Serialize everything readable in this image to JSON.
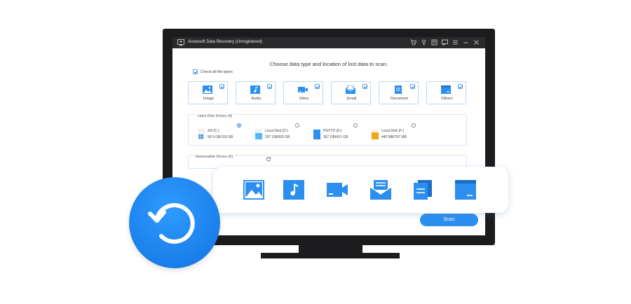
{
  "app": {
    "title": "Aiseesoft Data Recovery (Unregistered)",
    "titlebar_icons": [
      "cart-icon",
      "key-icon",
      "register-icon",
      "feedback-icon",
      "menu-icon",
      "minimize-icon",
      "close-icon"
    ]
  },
  "main": {
    "heading": "Choose data type and location of lost data to scan.",
    "check_all_label": "Check all file types",
    "file_types": [
      {
        "label": "Image",
        "icon": "image-icon",
        "checked": true
      },
      {
        "label": "Audio",
        "icon": "audio-icon",
        "checked": true
      },
      {
        "label": "Video",
        "icon": "video-icon",
        "checked": true
      },
      {
        "label": "Email",
        "icon": "email-icon",
        "checked": true
      },
      {
        "label": "Document",
        "icon": "document-icon",
        "checked": true
      },
      {
        "label": "Others",
        "icon": "others-icon",
        "checked": true
      }
    ],
    "hard_disk": {
      "label": "Hard Disk Drives (4)",
      "drives": [
        {
          "name": "Xiit (C:)",
          "size": "95.5 GB/118 GB",
          "selected": true
        },
        {
          "name": "Local Disk (D:)",
          "size": "297 GB/500 GB",
          "selected": false
        },
        {
          "name": "PGYTD (E:)",
          "size": "367 GB/431 GB",
          "selected": false
        },
        {
          "name": "Local Disk (F:)",
          "size": "445 MB/797 MB",
          "selected": false
        }
      ]
    },
    "removable": {
      "label": "Removable Drives (0)"
    },
    "scan_label": "Scan"
  },
  "colors": {
    "accent": "#2c8ff0",
    "frame": "#1c1c1e",
    "titlebar": "#2a2a2c",
    "circle": "#1a7fea"
  }
}
